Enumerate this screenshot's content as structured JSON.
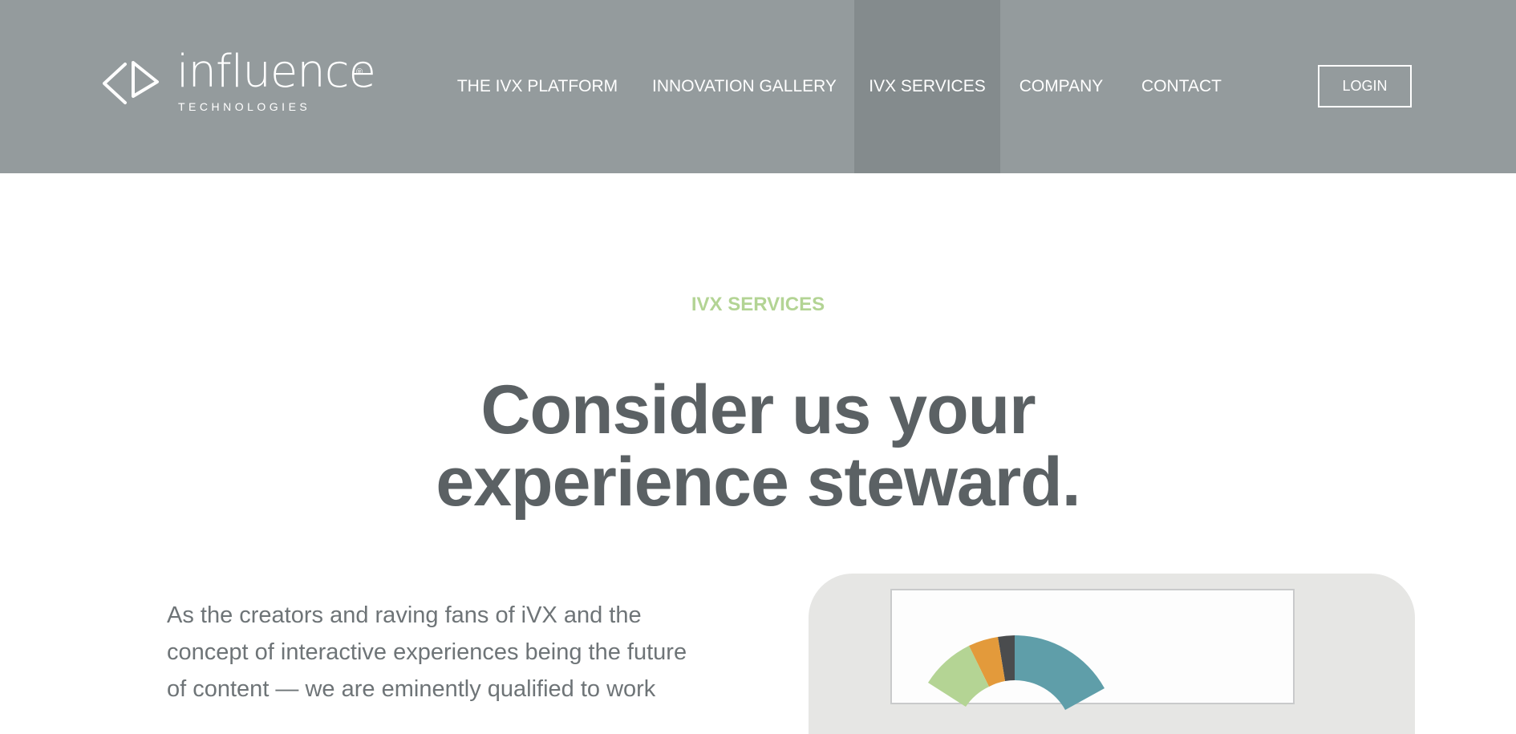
{
  "brand": {
    "name": "influence",
    "registered_mark": "®",
    "subtitle": "TECHNOLOGIES",
    "icon": "play-bracket-logo-icon"
  },
  "nav": {
    "items": [
      {
        "label": "THE IVX PLATFORM",
        "active": false
      },
      {
        "label": "INNOVATION GALLERY",
        "active": false
      },
      {
        "label": "IVX SERVICES",
        "active": true
      },
      {
        "label": "COMPANY",
        "active": false
      },
      {
        "label": "CONTACT",
        "active": false
      }
    ],
    "login_label": "LOGIN"
  },
  "hero": {
    "eyebrow": "IVX SERVICES",
    "headline_line1": "Consider us your",
    "headline_line2": "experience steward.",
    "body": "As the creators and raving fans of iVX and the concept of interactive experiences being the future of content — we are eminently qualified to work"
  },
  "colors": {
    "header_bg": "#949b9d",
    "nav_active_bg": "#848b8d",
    "eyebrow": "#b3d494",
    "headline": "#5b6164",
    "body_text": "#6e7477",
    "device_frame": "#e6e6e4",
    "donut_teal": "#5f9ea9",
    "donut_green": "#b4d494",
    "donut_orange": "#e39a3b",
    "donut_dark": "#4a4c4e"
  },
  "illustration": {
    "icon": "analytics-donut-chart-icon"
  }
}
